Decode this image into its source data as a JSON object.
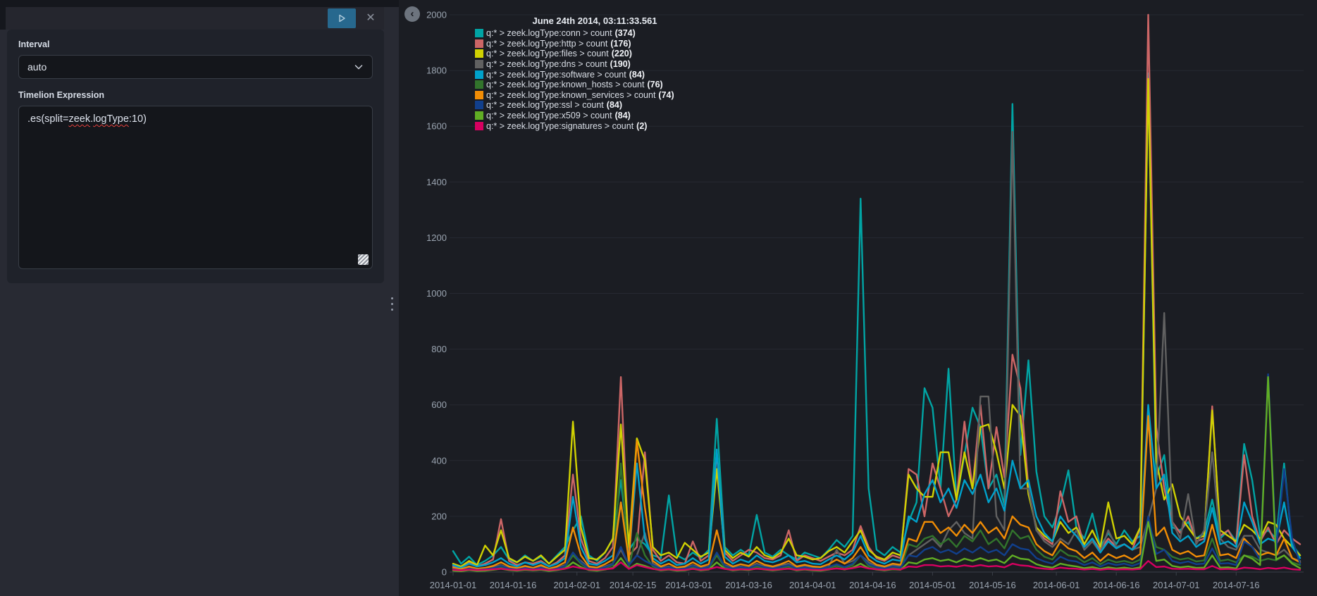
{
  "editor": {
    "run_button_icon": "play",
    "close_button_icon": "close",
    "interval_label": "Interval",
    "interval_value": "auto",
    "expression_label": "Timelion Expression",
    "expression": {
      "prefix": ".es(split=",
      "word1": "zeek",
      "dot": ".",
      "word2": "logType",
      "suffix": ":10)"
    }
  },
  "chart": {
    "back_icon": "chevron-left",
    "background": "#1b1d23",
    "grid_color": "#262932",
    "axis_color": "#3a3f48",
    "tick_label_color": "#9aa4b0"
  },
  "chart_data": {
    "type": "line",
    "title": "June 24th 2014, 03:11:33.561",
    "legend_position": "top-left",
    "grid": "horizontal",
    "ylim": [
      0,
      2000
    ],
    "y_ticks": [
      0,
      200,
      400,
      600,
      800,
      1000,
      1200,
      1400,
      1600,
      1800,
      2000
    ],
    "x_start": "2014-01-01",
    "x_step_days": 2,
    "n_points": 107,
    "total_days": 212,
    "x_ticks": [
      {
        "label": "2014-01-01",
        "day": 0
      },
      {
        "label": "2014-01-16",
        "day": 15
      },
      {
        "label": "2014-02-01",
        "day": 31
      },
      {
        "label": "2014-02-15",
        "day": 45
      },
      {
        "label": "2014-03-01",
        "day": 59
      },
      {
        "label": "2014-03-16",
        "day": 74
      },
      {
        "label": "2014-04-01",
        "day": 90
      },
      {
        "label": "2014-04-16",
        "day": 105
      },
      {
        "label": "2014-05-01",
        "day": 120
      },
      {
        "label": "2014-05-16",
        "day": 135
      },
      {
        "label": "2014-06-01",
        "day": 151
      },
      {
        "label": "2014-06-16",
        "day": 166
      },
      {
        "label": "2014-07-01",
        "day": 181
      },
      {
        "label": "2014-07-16",
        "day": 196
      }
    ],
    "series": [
      {
        "name": "q:* > zeek.logType:conn > count",
        "count": "374",
        "color": "#01A4A4",
        "values": [
          75,
          30,
          55,
          25,
          40,
          60,
          90,
          45,
          35,
          60,
          40,
          55,
          30,
          60,
          90,
          150,
          200,
          60,
          40,
          70,
          120,
          330,
          80,
          120,
          100,
          60,
          50,
          275,
          60,
          45,
          70,
          50,
          80,
          550,
          90,
          60,
          80,
          60,
          205,
          70,
          55,
          80,
          60,
          45,
          70,
          60,
          50,
          80,
          115,
          90,
          130,
          1340,
          300,
          80,
          60,
          90,
          70,
          180,
          250,
          660,
          590,
          300,
          730,
          260,
          420,
          590,
          520,
          300,
          350,
          240,
          1680,
          420,
          760,
          360,
          200,
          160,
          240,
          365,
          160,
          120,
          210,
          90,
          140,
          100,
          150,
          110,
          130,
          1790,
          340,
          420,
          160,
          150,
          180,
          120,
          140,
          260,
          120,
          150,
          110,
          460,
          330,
          130,
          150,
          120,
          390,
          100,
          60
        ]
      },
      {
        "name": "q:* > zeek.logType:http > count",
        "count": "176",
        "color": "#CC6666",
        "values": [
          20,
          15,
          35,
          20,
          30,
          45,
          190,
          40,
          25,
          35,
          30,
          40,
          20,
          35,
          60,
          350,
          120,
          40,
          30,
          50,
          90,
          700,
          60,
          90,
          430,
          80,
          40,
          60,
          35,
          30,
          110,
          40,
          60,
          430,
          70,
          40,
          60,
          80,
          70,
          50,
          45,
          60,
          150,
          40,
          60,
          50,
          40,
          55,
          70,
          60,
          80,
          165,
          90,
          50,
          40,
          60,
          50,
          370,
          350,
          200,
          390,
          300,
          200,
          260,
          540,
          300,
          600,
          300,
          520,
          340,
          780,
          660,
          300,
          150,
          120,
          100,
          290,
          180,
          200,
          90,
          120,
          80,
          120,
          90,
          100,
          80,
          160,
          2000,
          520,
          300,
          180,
          140,
          200,
          110,
          120,
          595,
          130,
          150,
          100,
          420,
          200,
          110,
          160,
          100,
          150,
          120,
          100
        ]
      },
      {
        "name": "q:* > zeek.logType:files > count",
        "count": "220",
        "color": "#D0D102",
        "values": [
          30,
          20,
          40,
          25,
          95,
          60,
          150,
          50,
          35,
          55,
          40,
          60,
          30,
          55,
          80,
          540,
          160,
          50,
          45,
          70,
          120,
          530,
          90,
          480,
          400,
          90,
          60,
          70,
          50,
          105,
          80,
          55,
          70,
          370,
          80,
          50,
          70,
          55,
          90,
          60,
          50,
          70,
          120,
          60,
          55,
          45,
          50,
          75,
          90,
          70,
          110,
          150,
          80,
          55,
          45,
          70,
          60,
          350,
          300,
          270,
          270,
          430,
          430,
          260,
          430,
          300,
          520,
          530,
          430,
          300,
          600,
          560,
          280,
          160,
          130,
          110,
          180,
          140,
          160,
          100,
          150,
          90,
          250,
          120,
          130,
          100,
          160,
          1770,
          400,
          260,
          315,
          200,
          160,
          120,
          130,
          580,
          150,
          130,
          110,
          170,
          150,
          120,
          180,
          170,
          120,
          90,
          60
        ]
      },
      {
        "name": "q:* > zeek.logType:dns > count",
        "count": "190",
        "color": "#616161",
        "values": [
          12,
          8,
          15,
          10,
          12,
          18,
          25,
          15,
          10,
          18,
          12,
          20,
          10,
          15,
          25,
          60,
          40,
          15,
          12,
          20,
          30,
          80,
          25,
          60,
          140,
          30,
          15,
          20,
          12,
          15,
          25,
          15,
          20,
          60,
          25,
          15,
          20,
          15,
          30,
          20,
          15,
          25,
          30,
          15,
          20,
          15,
          12,
          20,
          80,
          30,
          40,
          60,
          35,
          20,
          15,
          25,
          20,
          60,
          80,
          100,
          120,
          90,
          150,
          180,
          140,
          120,
          630,
          630,
          200,
          150,
          1580,
          300,
          300,
          150,
          110,
          90,
          120,
          100,
          150,
          80,
          110,
          70,
          150,
          90,
          100,
          80,
          90,
          190,
          300,
          930,
          180,
          120,
          280,
          100,
          150,
          430,
          120,
          90,
          80,
          130,
          130,
          80,
          70,
          60,
          80,
          50,
          40
        ]
      },
      {
        "name": "q:* > zeek.logType:software > count",
        "count": "84",
        "color": "#00A1CB",
        "values": [
          25,
          15,
          30,
          20,
          25,
          35,
          50,
          30,
          20,
          35,
          25,
          35,
          20,
          30,
          50,
          270,
          90,
          30,
          25,
          40,
          60,
          250,
          50,
          390,
          120,
          50,
          30,
          45,
          25,
          30,
          50,
          30,
          45,
          440,
          55,
          30,
          45,
          35,
          60,
          40,
          35,
          45,
          60,
          35,
          40,
          30,
          28,
          45,
          60,
          45,
          70,
          130,
          60,
          40,
          30,
          45,
          40,
          200,
          180,
          280,
          330,
          250,
          300,
          230,
          330,
          280,
          350,
          250,
          300,
          220,
          400,
          300,
          330,
          200,
          140,
          110,
          200,
          160,
          130,
          90,
          120,
          70,
          110,
          85,
          100,
          80,
          110,
          600,
          300,
          350,
          140,
          110,
          130,
          90,
          110,
          230,
          100,
          110,
          90,
          250,
          180,
          100,
          120,
          110,
          250,
          90,
          50
        ]
      },
      {
        "name": "q:* > zeek.logType:known_hosts > count",
        "count": "76",
        "color": "#32742C",
        "values": [
          8,
          5,
          10,
          6,
          8,
          12,
          18,
          10,
          7,
          12,
          8,
          12,
          6,
          10,
          18,
          60,
          30,
          10,
          8,
          14,
          25,
          390,
          20,
          140,
          60,
          20,
          10,
          15,
          8,
          10,
          18,
          10,
          15,
          60,
          18,
          10,
          15,
          12,
          20,
          14,
          10,
          15,
          20,
          10,
          14,
          10,
          9,
          15,
          22,
          15,
          25,
          60,
          22,
          14,
          10,
          16,
          13,
          100,
          90,
          120,
          130,
          100,
          120,
          90,
          130,
          110,
          150,
          100,
          120,
          85,
          150,
          120,
          130,
          80,
          55,
          45,
          80,
          60,
          55,
          35,
          50,
          28,
          45,
          35,
          40,
          32,
          45,
          180,
          90,
          80,
          55,
          45,
          50,
          38,
          42,
          120,
          40,
          45,
          35,
          60,
          55,
          40,
          48,
          42,
          60,
          35,
          25
        ]
      },
      {
        "name": "q:* > zeek.logType:known_services > count",
        "count": "74",
        "color": "#F18D05",
        "values": [
          15,
          10,
          20,
          12,
          15,
          22,
          35,
          20,
          14,
          22,
          15,
          25,
          12,
          20,
          35,
          160,
          60,
          20,
          16,
          28,
          45,
          250,
          40,
          470,
          230,
          40,
          20,
          30,
          16,
          20,
          35,
          20,
          28,
          150,
          35,
          20,
          28,
          22,
          40,
          26,
          20,
          28,
          40,
          20,
          26,
          20,
          18,
          28,
          45,
          30,
          50,
          90,
          45,
          26,
          20,
          30,
          26,
          120,
          110,
          180,
          180,
          140,
          160,
          130,
          170,
          140,
          180,
          140,
          160,
          120,
          200,
          170,
          160,
          100,
          75,
          60,
          110,
          85,
          75,
          50,
          70,
          40,
          65,
          50,
          60,
          45,
          65,
          560,
          130,
          160,
          80,
          65,
          75,
          55,
          60,
          170,
          60,
          65,
          50,
          120,
          90,
          60,
          70,
          60,
          120,
          50,
          35
        ]
      },
      {
        "name": "q:* > zeek.logType:ssl > count",
        "count": "84",
        "color": "#113F8C",
        "values": [
          10,
          6,
          12,
          8,
          10,
          14,
          22,
          12,
          9,
          14,
          10,
          15,
          8,
          12,
          22,
          70,
          35,
          12,
          10,
          17,
          28,
          90,
          25,
          60,
          40,
          25,
          12,
          18,
          10,
          12,
          22,
          12,
          18,
          70,
          22,
          12,
          18,
          14,
          25,
          17,
          12,
          18,
          25,
          12,
          17,
          12,
          11,
          18,
          28,
          18,
          30,
          60,
          28,
          17,
          12,
          20,
          16,
          60,
          55,
          80,
          90,
          70,
          80,
          65,
          85,
          70,
          90,
          70,
          80,
          60,
          100,
          85,
          80,
          50,
          38,
          30,
          55,
          42,
          38,
          25,
          35,
          20,
          32,
          25,
          30,
          22,
          32,
          200,
          65,
          80,
          40,
          32,
          38,
          28,
          30,
          85,
          30,
          32,
          25,
          110,
          90,
          45,
          710,
          80,
          370,
          120,
          30
        ]
      },
      {
        "name": "q:* > zeek.logType:x509 > count",
        "count": "84",
        "color": "#61AE24",
        "values": [
          5,
          3,
          7,
          4,
          5,
          8,
          12,
          7,
          5,
          8,
          6,
          8,
          4,
          7,
          12,
          35,
          18,
          7,
          5,
          9,
          15,
          50,
          12,
          30,
          22,
          12,
          6,
          9,
          5,
          6,
          12,
          6,
          9,
          35,
          12,
          6,
          9,
          7,
          13,
          9,
          6,
          9,
          13,
          6,
          9,
          6,
          5,
          9,
          14,
          9,
          16,
          30,
          14,
          9,
          6,
          10,
          8,
          35,
          30,
          45,
          50,
          40,
          45,
          35,
          48,
          40,
          50,
          40,
          45,
          32,
          60,
          48,
          45,
          28,
          20,
          16,
          30,
          24,
          20,
          14,
          18,
          11,
          17,
          13,
          16,
          12,
          17,
          180,
          40,
          45,
          22,
          17,
          20,
          15,
          16,
          60,
          16,
          17,
          13,
          60,
          48,
          25,
          700,
          45,
          60,
          30,
          14
        ]
      },
      {
        "name": "q:* > zeek.logType:signatures > count",
        "count": "2",
        "color": "#D70060",
        "values": [
          8,
          6,
          9,
          7,
          8,
          10,
          12,
          9,
          7,
          10,
          8,
          10,
          7,
          9,
          12,
          20,
          14,
          9,
          8,
          10,
          13,
          35,
          11,
          25,
          18,
          11,
          8,
          10,
          7,
          8,
          11,
          8,
          10,
          18,
          11,
          8,
          10,
          9,
          12,
          10,
          8,
          10,
          12,
          8,
          10,
          8,
          7,
          10,
          13,
          10,
          14,
          20,
          13,
          10,
          8,
          11,
          9,
          20,
          18,
          25,
          25,
          20,
          22,
          19,
          24,
          20,
          25,
          20,
          22,
          17,
          30,
          24,
          22,
          15,
          12,
          10,
          16,
          13,
          12,
          9,
          11,
          8,
          11,
          9,
          10,
          9,
          11,
          40,
          18,
          20,
          12,
          11,
          12,
          10,
          10,
          22,
          10,
          11,
          9,
          16,
          14,
          10,
          15,
          12,
          16,
          10,
          8
        ]
      }
    ]
  }
}
